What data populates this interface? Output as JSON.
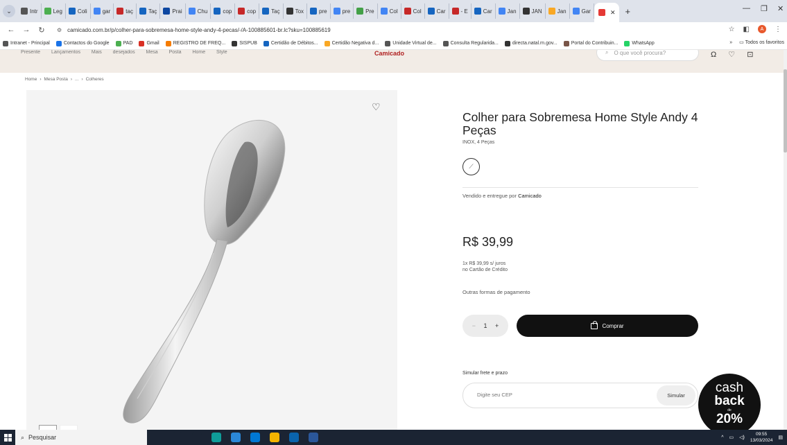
{
  "browser": {
    "tabs": [
      {
        "label": "Intr",
        "color": "#555"
      },
      {
        "label": "Leg",
        "color": "#4caf50"
      },
      {
        "label": "Coli",
        "color": "#1565c0"
      },
      {
        "label": "gar",
        "color": "#4285f4"
      },
      {
        "label": "taç",
        "color": "#c62828"
      },
      {
        "label": "Taç",
        "color": "#1565c0"
      },
      {
        "label": "Prai",
        "color": "#0d47a1"
      },
      {
        "label": "Chu",
        "color": "#4285f4"
      },
      {
        "label": "cop",
        "color": "#1565c0"
      },
      {
        "label": "cop",
        "color": "#c62828"
      },
      {
        "label": "Taç",
        "color": "#1565c0"
      },
      {
        "label": "Tox",
        "color": "#333"
      },
      {
        "label": "pre",
        "color": "#1565c0"
      },
      {
        "label": "pre",
        "color": "#4285f4"
      },
      {
        "label": "Pre",
        "color": "#43a047"
      },
      {
        "label": "Col",
        "color": "#4285f4"
      },
      {
        "label": "Col",
        "color": "#c62828"
      },
      {
        "label": "Car",
        "color": "#1565c0"
      },
      {
        "label": "- E",
        "color": "#c62828"
      },
      {
        "label": "Car",
        "color": "#1565c0"
      },
      {
        "label": "Jan",
        "color": "#4285f4"
      },
      {
        "label": "JAN",
        "color": "#333"
      },
      {
        "label": "Jan",
        "color": "#f9a825"
      },
      {
        "label": "Gar",
        "color": "#4285f4"
      }
    ],
    "active_tab_color": "#e53935",
    "new_tab": "+",
    "minimize": "—",
    "restore": "❐",
    "close": "✕",
    "url": "camicado.com.br/p/colher-para-sobremesa-home-style-andy-4-pecas/-/A-100885601-br.lc?sku=100885619",
    "profile_initial": "A"
  },
  "bookmarks": [
    {
      "label": "Intranet - Principal",
      "color": "#555"
    },
    {
      "label": "Contactos do Google",
      "color": "#1a73e8"
    },
    {
      "label": "PAD",
      "color": "#4caf50"
    },
    {
      "label": "Gmail",
      "color": "#d93025"
    },
    {
      "label": "REGISTRO DE FREQ...",
      "color": "#f57c00"
    },
    {
      "label": "SISPUB",
      "color": "#333"
    },
    {
      "label": "Certidão de Débitos...",
      "color": "#1565c0"
    },
    {
      "label": "Certidão Negativa d...",
      "color": "#f9a825"
    },
    {
      "label": "Unidade Virtual de...",
      "color": "#555"
    },
    {
      "label": "Consulta Regularida...",
      "color": "#555"
    },
    {
      "label": "directa.natal.rn.gov...",
      "color": "#333"
    },
    {
      "label": "Portal do Contribuin...",
      "color": "#795548"
    },
    {
      "label": "WhatsApp",
      "color": "#25d366"
    }
  ],
  "bookmarks_more": "»",
  "bookmarks_all": "Todos os favoritos",
  "site": {
    "nav_fragments": "Presente Lançamentos Mais desejados Mesa Posta Home Style",
    "logo": "Camicado",
    "search_placeholder": "O que você procura?",
    "icons_text": "Ω ♡ ⊡"
  },
  "breadcrumb": [
    "Home",
    "›",
    "Mesa Posta",
    "›",
    "...",
    "›",
    "Colheres"
  ],
  "product": {
    "title": "Colher para Sobremesa Home Style Andy 4 Peças",
    "subtitle": "INOX, 4 Peças",
    "seller_prefix": "Vendido e entregue por",
    "seller_name": "Camicado",
    "price": "R$ 39,99",
    "installment_line1": "1x R$ 39,99 s/ juros",
    "installment_line2": "no Cartão de Crédito",
    "other_payments": "Outras formas de pagamento",
    "qty_minus": "−",
    "qty_value": "1",
    "qty_plus": "+",
    "buy_label": "Comprar",
    "shipping_label": "Simular frete e prazo",
    "cep_placeholder": "Digite seu CEP",
    "simulate_label": "Simular"
  },
  "cashback": {
    "line1": "cash",
    "line2": "back",
    "line3": "de",
    "line4": "20%"
  },
  "taskbar": {
    "search_placeholder": "Pesquisar",
    "apps": [
      {
        "name": "cortana",
        "color": "#1b2433"
      },
      {
        "name": "task-view",
        "color": "#1b2433"
      },
      {
        "name": "edge",
        "color": "#0f9d9a"
      },
      {
        "name": "store",
        "color": "#2b88d8"
      },
      {
        "name": "mail",
        "color": "#0078d4"
      },
      {
        "name": "chrome",
        "color": "#f4b400"
      },
      {
        "name": "explorer",
        "color": "#0a64ad"
      },
      {
        "name": "word",
        "color": "#2b579a"
      }
    ],
    "time": "09:55",
    "date": "13/03/2024"
  }
}
